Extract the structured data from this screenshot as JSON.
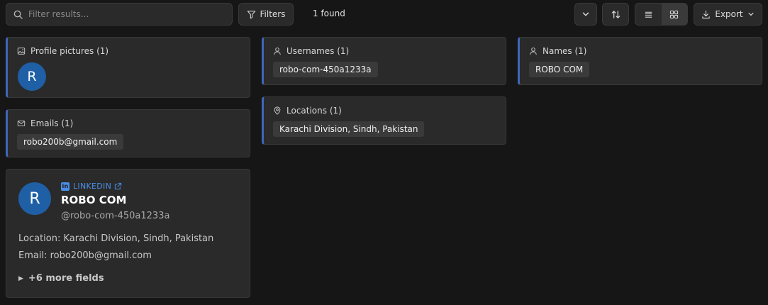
{
  "toolbar": {
    "search_placeholder": "Filter results...",
    "filters_label": "Filters",
    "found_text": "1 found",
    "export_label": "Export"
  },
  "cards": {
    "profile_pictures": {
      "title": "Profile pictures (1)",
      "avatar_letter": "R"
    },
    "usernames": {
      "title": "Usernames (1)",
      "values": [
        "robo-com-450a1233a"
      ]
    },
    "names": {
      "title": "Names (1)",
      "values": [
        "ROBO COM"
      ]
    },
    "emails": {
      "title": "Emails (1)",
      "values": [
        "robo200b@gmail.com"
      ]
    },
    "locations": {
      "title": "Locations (1)",
      "values": [
        "Karachi Division, Sindh, Pakistan"
      ]
    }
  },
  "profile": {
    "avatar_letter": "R",
    "source_badge": "in",
    "source": "LINKEDIN",
    "name": "ROBO COM",
    "handle": "@robo-com-450a1233a",
    "location_line": "Location: Karachi Division, Sindh, Pakistan",
    "email_line": "Email: robo200b@gmail.com",
    "more_fields": "+6 more fields"
  },
  "colors": {
    "background": "#161616",
    "card": "#2a2a2a",
    "accent_border": "#3f66b8",
    "avatar": "#1f5fa5",
    "link": "#4b8ee6"
  },
  "icons": {
    "search": "search-icon",
    "filters": "filter-icon",
    "chevron": "chevron-down-icon",
    "sort": "sort-arrows-icon",
    "list_view": "list-view-icon",
    "grid_view": "grid-view-icon",
    "export": "download-icon",
    "image": "image-icon",
    "user": "user-icon",
    "mail": "mail-icon",
    "location": "location-pin-icon",
    "external": "external-link-icon"
  }
}
